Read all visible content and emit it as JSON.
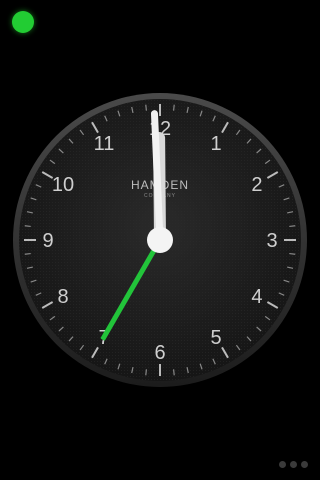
{
  "indicator": {
    "color": "#22cc33"
  },
  "clock": {
    "brand": "HAMDEN",
    "brand_sub": "COMPANY",
    "numerals": [
      "12",
      "1",
      "2",
      "3",
      "4",
      "5",
      "6",
      "7",
      "8",
      "9",
      "10",
      "11"
    ],
    "time": {
      "hour": 11,
      "minute": 59,
      "second": 35
    },
    "second_hand_color": "#22c43a"
  },
  "pager": {
    "count": 3
  }
}
